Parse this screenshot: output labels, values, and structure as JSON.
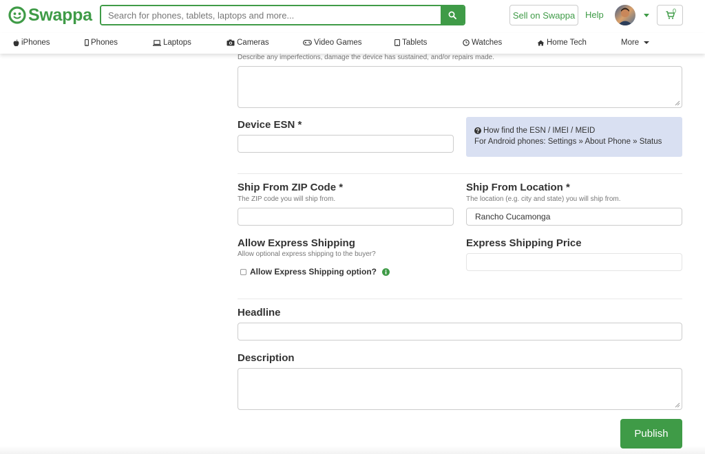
{
  "brand": {
    "name": "Swappa",
    "color": "#3f9b47"
  },
  "header": {
    "search_placeholder": "Search for phones, tablets, laptops and more...",
    "sell_label": "Sell on Swappa",
    "help_label": "Help",
    "cart_count": "0",
    "icons": [
      "search-icon",
      "avatar",
      "chevron-down-icon",
      "cart-icon"
    ]
  },
  "nav": {
    "items": [
      {
        "label": "iPhones",
        "icon": "apple-icon"
      },
      {
        "label": "Phones",
        "icon": "phone-icon"
      },
      {
        "label": "Laptops",
        "icon": "laptop-icon"
      },
      {
        "label": "Cameras",
        "icon": "camera-icon"
      },
      {
        "label": "Video Games",
        "icon": "gamepad-icon"
      },
      {
        "label": "Tablets",
        "icon": "tablet-icon"
      },
      {
        "label": "Watches",
        "icon": "watch-icon"
      },
      {
        "label": "Home Tech",
        "icon": "home-icon"
      }
    ],
    "more_label": "More"
  },
  "form": {
    "condition_hint": "Describe any imperfections, damage the device has sustained, and/or repairs made.",
    "condition_value": "",
    "esn": {
      "label": "Device ESN *",
      "value": ""
    },
    "esn_info": {
      "title": "How find the ESN / IMEI / MEID",
      "body": "For Android phones: Settings » About Phone » Status",
      "background": "#d9e0f2"
    },
    "zip": {
      "label": "Ship From ZIP Code *",
      "hint": "The ZIP code you will ship from.",
      "value": ""
    },
    "location": {
      "label": "Ship From Location *",
      "hint": "The location (e.g. city and state) you will ship from.",
      "value": "Rancho Cucamonga"
    },
    "express": {
      "label": "Allow Express Shipping",
      "hint": "Allow optional express shipping to the buyer?",
      "checkbox_label": "Allow Express Shipping option?",
      "checked": false
    },
    "express_price": {
      "label": "Express Shipping Price",
      "value": ""
    },
    "headline": {
      "label": "Headline",
      "value": ""
    },
    "description": {
      "label": "Description",
      "value": ""
    },
    "publish_label": "Publish"
  }
}
